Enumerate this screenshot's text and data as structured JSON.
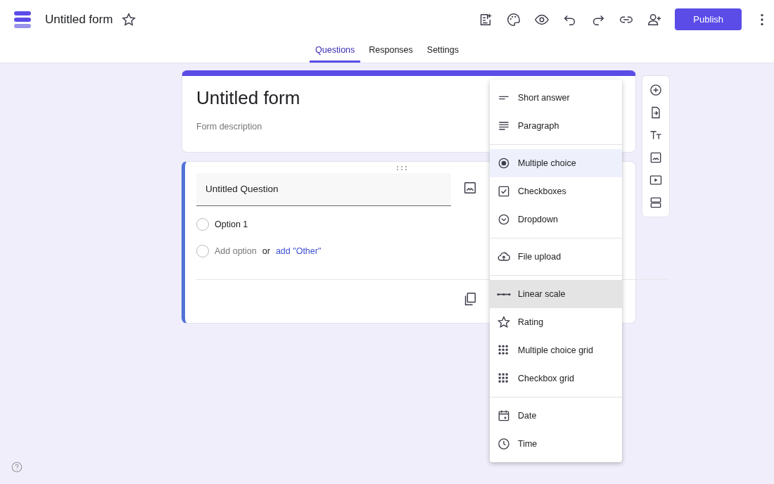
{
  "header": {
    "title": "Untitled form",
    "starred": false,
    "publish": "Publish"
  },
  "tabs": [
    {
      "label": "Questions",
      "selected": true
    },
    {
      "label": "Responses",
      "selected": false
    },
    {
      "label": "Settings",
      "selected": false
    }
  ],
  "form": {
    "title": "Untitled form",
    "description_placeholder": "Form description"
  },
  "question": {
    "title": "Untitled Question",
    "options": [
      {
        "label": "Option 1"
      }
    ],
    "add_option": "Add option",
    "or": "or",
    "add_other": "add \"Other\""
  },
  "type_menu": [
    [
      {
        "kind": "short",
        "label": "Short answer",
        "selected": false,
        "hovered": false
      },
      {
        "kind": "paragraph",
        "label": "Paragraph",
        "selected": false,
        "hovered": false
      }
    ],
    [
      {
        "kind": "radio",
        "label": "Multiple choice",
        "selected": true,
        "hovered": false
      },
      {
        "kind": "checkbox",
        "label": "Checkboxes",
        "selected": false,
        "hovered": false
      },
      {
        "kind": "dropdown",
        "label": "Dropdown",
        "selected": false,
        "hovered": false
      }
    ],
    [
      {
        "kind": "upload",
        "label": "File upload",
        "selected": false,
        "hovered": false
      }
    ],
    [
      {
        "kind": "scale",
        "label": "Linear scale",
        "selected": false,
        "hovered": true
      },
      {
        "kind": "star",
        "label": "Rating",
        "selected": false,
        "hovered": false
      },
      {
        "kind": "radiogrid",
        "label": "Multiple choice grid",
        "selected": false,
        "hovered": false
      },
      {
        "kind": "checkgrid",
        "label": "Checkbox grid",
        "selected": false,
        "hovered": false
      }
    ],
    [
      {
        "kind": "date",
        "label": "Date",
        "selected": false,
        "hovered": false
      },
      {
        "kind": "time",
        "label": "Time",
        "selected": false,
        "hovered": false
      }
    ]
  ]
}
